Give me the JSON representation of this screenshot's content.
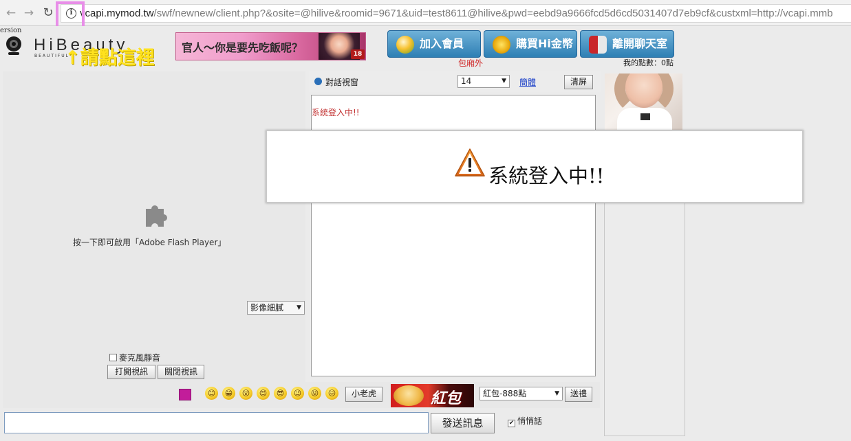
{
  "browser": {
    "back_icon": "←",
    "forward_icon": "→",
    "reload_icon": "↻",
    "url_host": "vcapi.mymod.tw",
    "url_rest": "/swf/newnew/client.php?&osite=@hilive&roomid=9671&uid=test8611@hilive&pwd=eebd9a9666fcd5d6cd5031407d7eb9cf&custxml=http://vcapi.mmb"
  },
  "header": {
    "version_text": "ersion",
    "logo_text": "HiBeauty",
    "logo_sub": "BEAUTIFUL",
    "click_hint": "↑請點這裡",
    "banner_text": "官人～你是要先吃飯呢？",
    "banner_badge": "18",
    "buttons": {
      "join": "加入會員",
      "buy_coins": "購買Hi金幣",
      "leave": "離開聊天室"
    },
    "private_label": "包廂外",
    "points_label": "我的點數：0點"
  },
  "video": {
    "flash_text": "按一下即可啟用「Adobe Flash Player」",
    "quality_value": "影像細膩",
    "mic_mute_label": "麥克風靜音",
    "open_video_label": "打開視訊",
    "close_video_label": "關閉視訊"
  },
  "chat": {
    "title": "對話視窗",
    "font_size_value": "14",
    "variant_link": "簡體",
    "clear_label": "清屏",
    "messages": [
      "系統登入中!!"
    ]
  },
  "bottom": {
    "swatch_color": "#c21d9a",
    "emojis": [
      "😊",
      "😁",
      "😲",
      "😍",
      "😎",
      "😉",
      "😝",
      "😖"
    ],
    "tiger_label": "小老虎",
    "hongbao_text": "紅包",
    "gift_value": "紅包-888點",
    "send_gift_label": "送禮",
    "send_msg_label": "發送訊息",
    "whisper_label": "悄悄話",
    "whisper_mark": "✔"
  },
  "modal": {
    "message": "系統登入中!!"
  }
}
